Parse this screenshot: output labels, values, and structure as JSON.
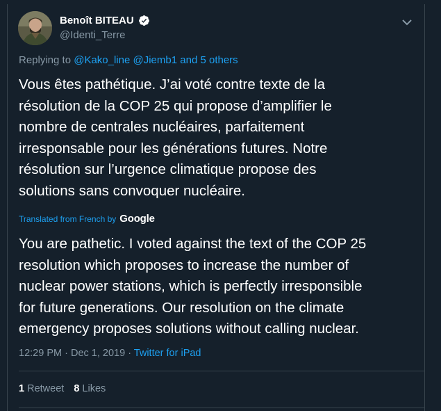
{
  "tweet": {
    "display_name": "Benoît BITEAU",
    "handle": "@Identi_Terre",
    "reply": {
      "prefix": "Replying to ",
      "user1": "@Kako_line",
      "user2": "@Jiemb1",
      "and_text": " and ",
      "others": "5 others"
    },
    "text": "Vous êtes pathétique. J’ai voté contre texte de la\nrésolution de la COP 25 qui propose d’amplifier le\nnombre de centrales nucléaires, parfaitement\nirresponsable pour les générations futures. Notre\nrésolution sur l’urgence climatique propose des\nsolutions sans convoquer nucléaire.",
    "translation": {
      "label": "Translated from French by",
      "provider": "Google",
      "text": "You are pathetic. I voted against the text of the COP 25\nresolution which proposes to increase the number of\nnuclear power stations, which is perfectly irresponsible\nfor future generations. Our resolution on the climate\nemergency proposes solutions without calling nuclear."
    },
    "meta": {
      "time": "12:29 PM",
      "date": "Dec 1, 2019",
      "separator": " · ",
      "source": "Twitter for iPad"
    },
    "stats": {
      "retweets": "1",
      "retweets_label": "Retweet",
      "likes": "8",
      "likes_label": "Likes"
    }
  },
  "colors": {
    "background": "#15202b",
    "text": "#ffffff",
    "secondary": "#8899a6",
    "accent": "#1da1f2",
    "border": "#38444d"
  },
  "icons": {
    "verified": "verified-badge-icon",
    "caret": "chevron-down-icon"
  }
}
